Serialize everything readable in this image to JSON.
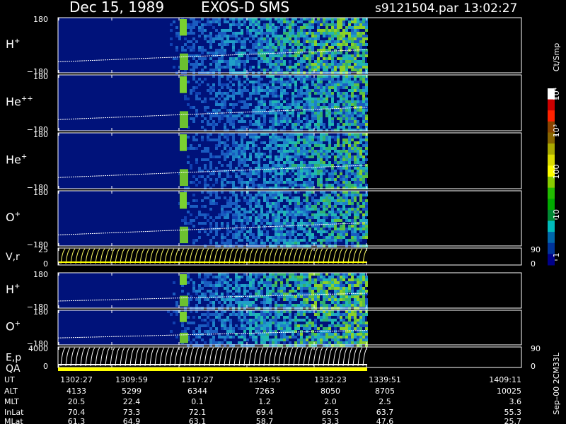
{
  "header": {
    "date": "Dec 15, 1989",
    "mission": "EXOS-D SMS",
    "file": "s9121504.par",
    "time": "13:02:27"
  },
  "chart_data": {
    "type": "heatmap",
    "x_ticks": [
      "1302:27",
      "1309:59",
      "1317:27",
      "1324:55",
      "1332:23",
      "1339:51",
      "1409:11"
    ],
    "panels": [
      {
        "id": "h-plus",
        "species": "H",
        "charge": "+",
        "ylim": [
          -180,
          180
        ],
        "ytick_labels": [
          "180",
          "−180"
        ]
      },
      {
        "id": "he-plus-plus",
        "species": "He",
        "charge": "++",
        "ylim": [
          -180,
          180
        ],
        "ytick_labels": [
          "180",
          "−180"
        ]
      },
      {
        "id": "he-plus",
        "species": "He",
        "charge": "+",
        "ylim": [
          -180,
          180
        ],
        "ytick_labels": [
          "180",
          "−180"
        ]
      },
      {
        "id": "o-plus",
        "species": "O",
        "charge": "+",
        "ylim": [
          -180,
          180
        ],
        "ytick_labels": [
          "180",
          "−180"
        ]
      },
      {
        "id": "v-r",
        "label": "V,r",
        "ytick_labels": [
          "25",
          "0"
        ],
        "right_ticks": [
          "90",
          "0"
        ]
      },
      {
        "id": "h-plus-2",
        "species": "H",
        "charge": "+",
        "ylim": [
          -180,
          180
        ],
        "ytick_labels": [
          "180",
          "−180"
        ]
      },
      {
        "id": "o-plus-2",
        "species": "O",
        "charge": "+",
        "ylim": [
          -180,
          180
        ],
        "ytick_labels": [
          "180",
          "−180"
        ]
      },
      {
        "id": "e-p",
        "label": "E,p",
        "ytick_labels": [
          "4000",
          "0"
        ],
        "right_ticks": [
          "90",
          "0"
        ]
      }
    ],
    "qa_label": "QA",
    "colorbar": {
      "label": "Ct/Smp",
      "scale": "log",
      "range": [
        1,
        10000
      ],
      "tick_labels": [
        "10⁴",
        "10³",
        "100",
        "10",
        "1"
      ],
      "colors": [
        "#ffffff",
        "#cc0000",
        "#ff2200",
        "#884400",
        "#886600",
        "#aaaa00",
        "#dddd00",
        "#ffff00",
        "#88cc00",
        "#22bb00",
        "#00aa00",
        "#008833",
        "#00bbbb",
        "#0066aa",
        "#003399",
        "#000088"
      ]
    },
    "orbit_table": {
      "row_labels": [
        "UT",
        "ALT",
        "MLT",
        "InLat",
        "MLat"
      ],
      "columns": [
        [
          "1302:27",
          "4133",
          "20.5",
          "70.4",
          "61.3"
        ],
        [
          "1309:59",
          "5299",
          "22.4",
          "73.3",
          "64.9"
        ],
        [
          "1317:27",
          "6344",
          "0.1",
          "72.1",
          "63.1"
        ],
        [
          "1324:55",
          "7263",
          "1.2",
          "69.4",
          "58.7"
        ],
        [
          "1332:23",
          "8050",
          "2.0",
          "66.5",
          "53.3"
        ],
        [
          "1339:51",
          "8705",
          "2.5",
          "63.7",
          "47.6"
        ],
        [
          "1409:11",
          "10025",
          "3.6",
          "55.3",
          "25.7"
        ]
      ]
    },
    "footer_tag": "Sep–00 2CM33L"
  }
}
